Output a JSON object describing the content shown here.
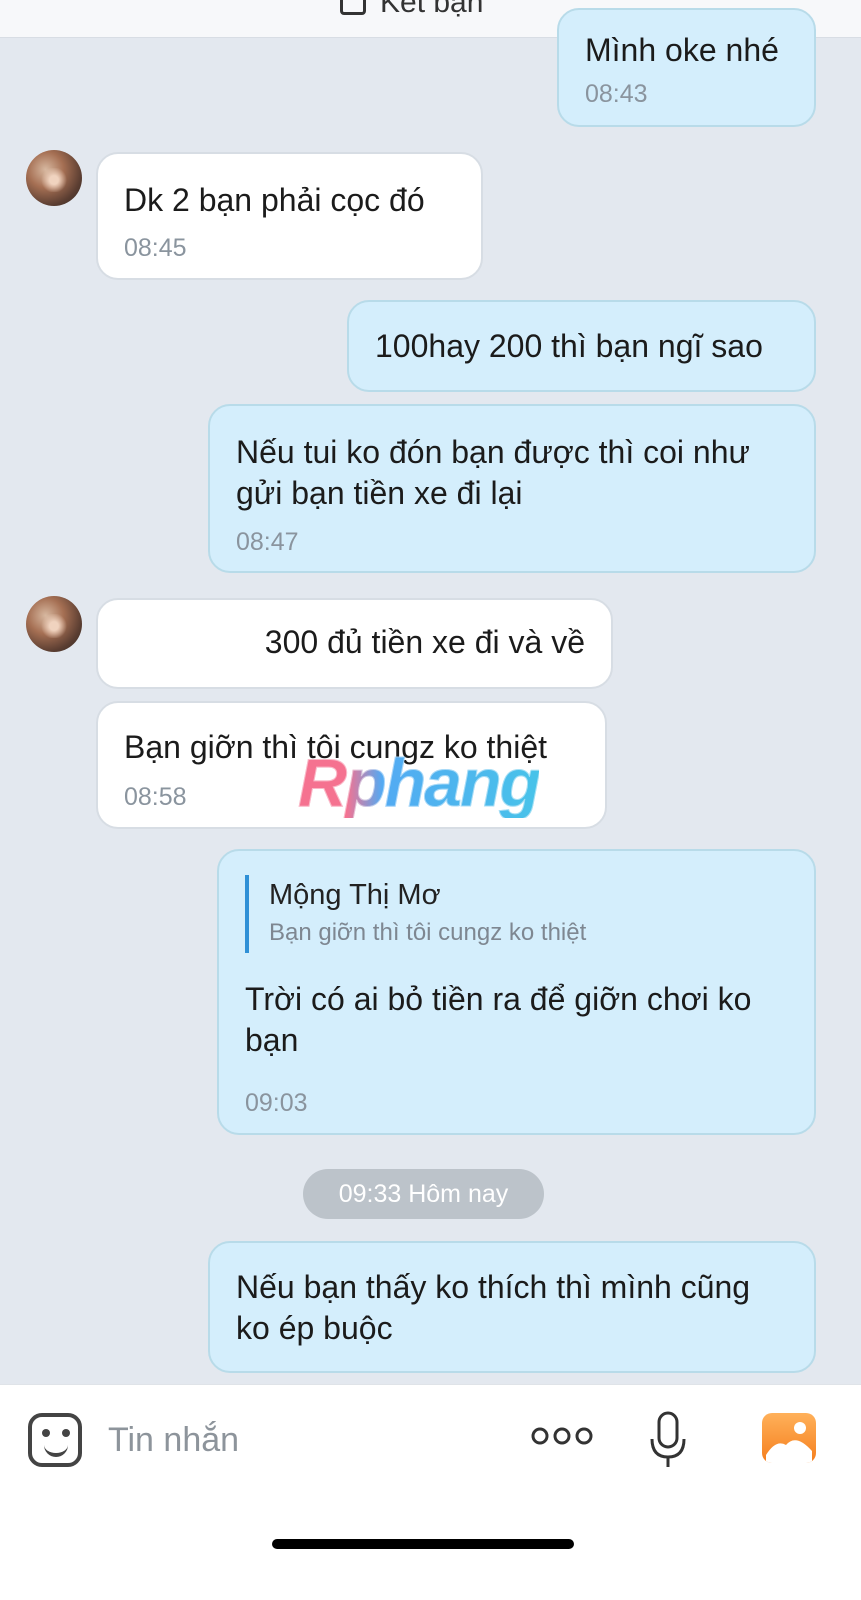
{
  "header": {
    "add_friend_label": "Kết bạn"
  },
  "messages": [
    {
      "direction": "out",
      "text": "Mình oke nhé",
      "time": "08:43"
    },
    {
      "direction": "in",
      "text": "Dk 2 bạn phải cọc đó",
      "time": "08:45"
    },
    {
      "direction": "out",
      "text": "100hay 200 thì bạn ngĩ sao",
      "time": ""
    },
    {
      "direction": "out",
      "text_lines": [
        "Nếu tui ko đón bạn được thì coi như",
        "gửi bạn tiền xe đi lại"
      ],
      "time": "08:47"
    },
    {
      "direction": "in",
      "text": "300 đủ tiền xe đi và về",
      "time": ""
    },
    {
      "direction": "in",
      "text": "Bạn giỡn thì tôi cungz ko thiệt",
      "time": "08:58"
    },
    {
      "direction": "out",
      "reply_to": {
        "name": "Mộng Thị Mơ",
        "snippet": "Bạn giỡn thì tôi cungz ko thiệt"
      },
      "text_lines": [
        "Trời có ai bỏ tiền ra để giỡn chơi ko",
        "bạn"
      ],
      "time": "09:03"
    },
    {
      "direction": "out",
      "text_lines": [
        "Nếu bạn thấy ko thích thì mình cũng",
        "ko ép buộc"
      ],
      "time": ""
    }
  ],
  "day_separator": "09:33 Hôm nay",
  "composer": {
    "placeholder": "Tin nhắn",
    "emoji_icon": "sticker-smile-icon",
    "more_icon": "more-dots-icon",
    "mic_icon": "microphone-icon",
    "image_icon": "photo-gallery-icon"
  },
  "watermark": "Rphang"
}
